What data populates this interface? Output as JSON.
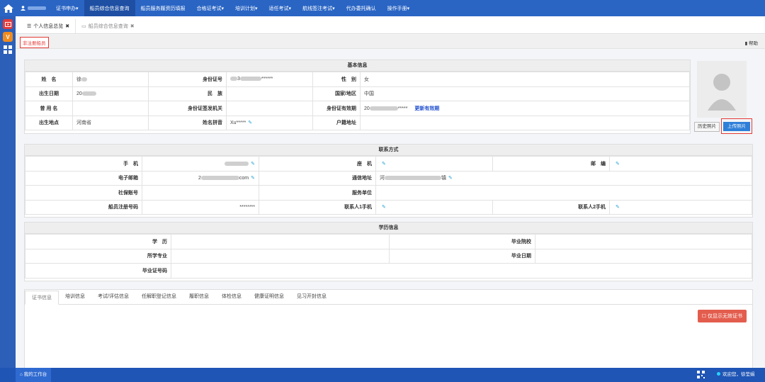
{
  "nav": {
    "items": [
      "证书申办",
      "船员综合信息查询",
      "船员服务履资历填报",
      "合格证考试",
      "培训计划",
      "适任考试",
      "航线签注考试",
      "代办委托确认",
      "操作手册"
    ],
    "dropdown": [
      true,
      false,
      false,
      true,
      true,
      true,
      true,
      false,
      true
    ],
    "active_index": 1
  },
  "page_tabs": [
    {
      "label": "个人信息总览",
      "close": "✖"
    },
    {
      "label": "船员综合信息查询",
      "close": "✖"
    }
  ],
  "subbar": {
    "unregistered": "非注册船员",
    "help": "帮助"
  },
  "basic": {
    "title": "基本信息",
    "labels": {
      "name": "姓　名",
      "id_no": "身份证号",
      "gender": "性　别",
      "birth": "出生日期",
      "ethnicity": "民　族",
      "nationality": "国家/地区",
      "former_name": "曾 用 名",
      "id_issuer": "身份证签发机关",
      "id_valid": "身份证有效期",
      "birthplace": "出生地点",
      "pinyin": "姓名拼音",
      "household": "户籍地址"
    },
    "values": {
      "name": "徐",
      "id_no_prefix": "3",
      "id_no_suffix": "******",
      "gender": "女",
      "birth": "20",
      "ethnicity": "",
      "nationality": "中国",
      "former_name": "",
      "id_issuer": "",
      "id_valid_prefix": "20",
      "id_valid_suffix": "*****",
      "id_update": "更新有效期",
      "birthplace": "河南省",
      "pinyin": "Xu*****",
      "household": ""
    },
    "history_photo": "历史照片",
    "upload_photo": "上传照片"
  },
  "contact": {
    "title": "联系方式",
    "labels": {
      "mobile": "手　机",
      "landline": "座　机",
      "postcode": "邮　编",
      "email": "电子邮箱",
      "address": "通信地址",
      "social_security": "社保账号",
      "service_unit": "服务单位",
      "reg_no": "船员注册号码",
      "contact1": "联系人1手机",
      "contact2": "联系人2手机"
    },
    "values": {
      "email_prefix": "2",
      "email_suffix": "com",
      "address_prefix": "河",
      "address_suffix": "镇",
      "reg_no": "********"
    }
  },
  "education": {
    "title": "学历信息",
    "labels": {
      "degree": "学　历",
      "school": "毕业院校",
      "major": "所学专业",
      "grad_date": "毕业日期",
      "cert_no": "毕业证号码"
    }
  },
  "cert_tabs": [
    "证书信息",
    "培训信息",
    "考试/评估信息",
    "任解职登记信息",
    "履职信息",
    "体检信息",
    "健康证明信息",
    "见习开封信息"
  ],
  "cert_active": 0,
  "only_invalid": "仅显示无效证书",
  "status": {
    "workbench": "我的工作台",
    "greeting": "欢迎您，徐莹娟"
  },
  "colors": {
    "nav": "#2a65c4",
    "nav_active": "#1e4fa3",
    "status_bar": "#1f55b5",
    "alert_red": "#e53935",
    "primary_btn": "#2f7fd8",
    "danger_btn": "#e35d4e",
    "edit_icon": "#2aa4d6"
  }
}
